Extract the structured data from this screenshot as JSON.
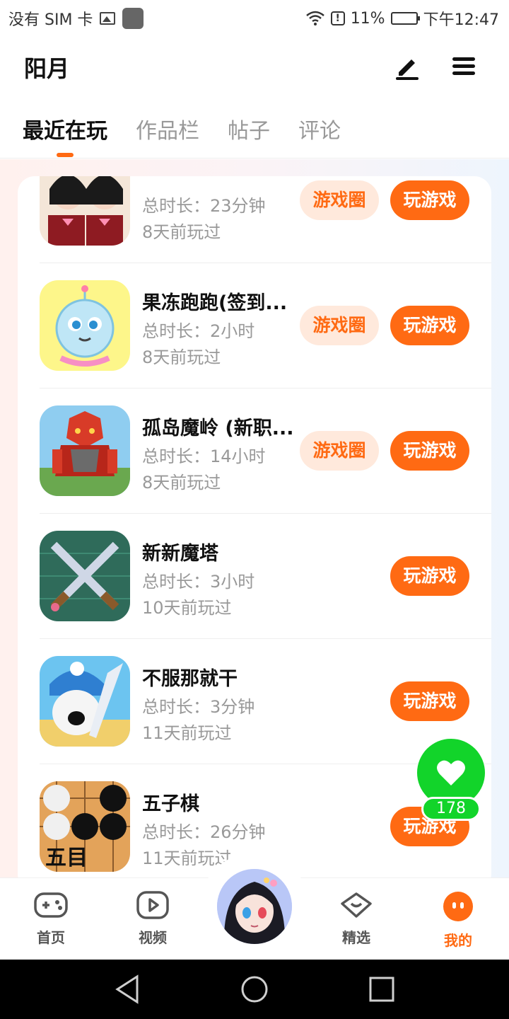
{
  "status_bar": {
    "carrier": "没有 SIM 卡",
    "battery": "11%",
    "time": "下午12:47"
  },
  "header": {
    "user_name": "阳月",
    "icons": {
      "edit": "edit-icon",
      "menu": "menu-icon"
    }
  },
  "tabs": [
    {
      "label": "最近在玩",
      "active": true
    },
    {
      "label": "作品栏",
      "active": false
    },
    {
      "label": "帖子",
      "active": false
    },
    {
      "label": "评论",
      "active": false
    }
  ],
  "games": [
    {
      "title": "",
      "duration": "总时长：23分钟",
      "last_played": "8天前玩过",
      "has_circle": true
    },
    {
      "title": "果冻跑跑(签到...",
      "duration": "总时长：2小时",
      "last_played": "8天前玩过",
      "has_circle": true
    },
    {
      "title": "孤岛魔岭 (新职...",
      "duration": "总时长：14小时",
      "last_played": "8天前玩过",
      "has_circle": true
    },
    {
      "title": "新新魔塔",
      "duration": "总时长：3小时",
      "last_played": "10天前玩过",
      "has_circle": false
    },
    {
      "title": "不服那就干",
      "duration": "总时长：3分钟",
      "last_played": "11天前玩过",
      "has_circle": false
    },
    {
      "title": "五子棋",
      "duration": "总时长：26分钟",
      "last_played": "11天前玩过",
      "has_circle": false
    }
  ],
  "buttons": {
    "circle": "游戏圈",
    "play": "玩游戏"
  },
  "gomoku_label": "五目",
  "like": {
    "count": "178"
  },
  "bottom_nav": [
    {
      "label": "首页",
      "icon": "gamepad-icon",
      "active": false
    },
    {
      "label": "视频",
      "icon": "video-icon",
      "active": false
    },
    {
      "label": "精选",
      "icon": "heart-chat-icon",
      "active": false
    },
    {
      "label": "我的",
      "icon": "me-icon",
      "active": true
    }
  ],
  "colors": {
    "accent": "#ff6a13",
    "accent_light": "#ffe9dc",
    "like": "#12d42a"
  }
}
